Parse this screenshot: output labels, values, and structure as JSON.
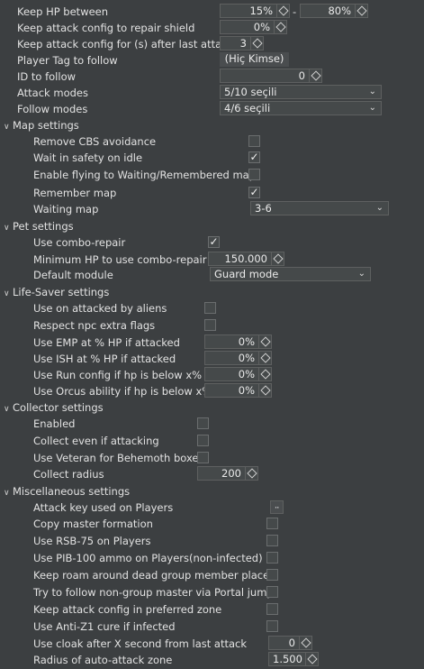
{
  "top": {
    "keep_hp_label": "Keep HP between",
    "hp_min": "15%",
    "hp_dash": "-",
    "hp_max": "80%",
    "keep_attack_repair_label": "Keep attack config to repair shield",
    "keep_attack_repair_value": "0%",
    "keep_attack_seconds_label": "Keep attack config for (s) after last attack",
    "keep_attack_seconds_value": "3",
    "player_tag_label": "Player Tag to follow",
    "player_tag_value": "(Hiç Kimse)",
    "id_follow_label": "ID to follow",
    "id_follow_value": "0",
    "attack_modes_label": "Attack modes",
    "attack_modes_value": "5/10 seçili",
    "follow_modes_label": "Follow modes",
    "follow_modes_value": "4/6 seçili"
  },
  "map_settings": {
    "title": "Map settings",
    "remove_cbs_label": "Remove CBS avoidance",
    "remove_cbs_checked": false,
    "wait_safety_label": "Wait in safety on idle",
    "wait_safety_checked": true,
    "enable_flying_label": "Enable flying to Waiting/Remembered map",
    "enable_flying_checked": false,
    "remember_map_label": "Remember map",
    "remember_map_checked": true,
    "waiting_map_label": "Waiting map",
    "waiting_map_value": "3-6"
  },
  "pet_settings": {
    "title": "Pet settings",
    "combo_repair_label": "Use combo-repair",
    "combo_repair_checked": true,
    "min_hp_label": "Minimum HP to use combo-repair",
    "min_hp_value": "150.000",
    "default_module_label": "Default module",
    "default_module_value": "Guard mode"
  },
  "life_saver": {
    "title": "Life-Saver settings",
    "attacked_aliens_label": "Use on attacked by aliens",
    "attacked_aliens_checked": false,
    "respect_npc_label": "Respect npc extra flags",
    "respect_npc_checked": false,
    "emp_label": "Use EMP at % HP if attacked",
    "emp_value": "0%",
    "ish_label": "Use ISH at % HP if attacked",
    "ish_value": "0%",
    "run_label": "Use Run config if hp is below x%",
    "run_value": "0%",
    "orcus_label": "Use Orcus ability if hp is below x%",
    "orcus_value": "0%"
  },
  "collector": {
    "title": "Collector settings",
    "enabled_label": "Enabled",
    "enabled_checked": false,
    "collect_attacking_label": "Collect even if attacking",
    "collect_attacking_checked": false,
    "veteran_label": "Use Veteran for Behemoth boxes",
    "veteran_checked": false,
    "radius_label": "Collect radius",
    "radius_value": "200"
  },
  "misc": {
    "title": "Miscellaneous settings",
    "attack_key_label": "Attack key used on Players",
    "attack_key_button": "⠤",
    "copy_master_label": "Copy master formation",
    "copy_master_checked": false,
    "rsb_label": "Use RSB-75 on Players",
    "rsb_checked": false,
    "pib_label": "Use PIB-100 ammo on Players(non-infected)",
    "pib_checked": false,
    "roam_label": "Keep roam around dead group member place",
    "roam_checked": false,
    "portal_label": "Try to follow non-group master via Portal jump",
    "portal_checked": false,
    "preferred_zone_label": "Keep attack config in preferred zone",
    "preferred_zone_checked": false,
    "anti_z1_label": "Use Anti-Z1 cure if infected",
    "anti_z1_checked": false,
    "cloak_label": "Use cloak after X second from last attack",
    "cloak_value": "0",
    "radius_auto_label": "Radius of auto-attack zone",
    "radius_auto_value": "1.500"
  },
  "icons": {
    "spinner": "diamond-spinner-icon",
    "dropdown": "chevron-down-icon",
    "section": "section-expanded-chevron-icon",
    "check": "checkmark-icon"
  },
  "colors": {
    "background": "#3c3f41",
    "field": "#45494a",
    "border": "#5e6060",
    "text": "#e2e2e2"
  }
}
